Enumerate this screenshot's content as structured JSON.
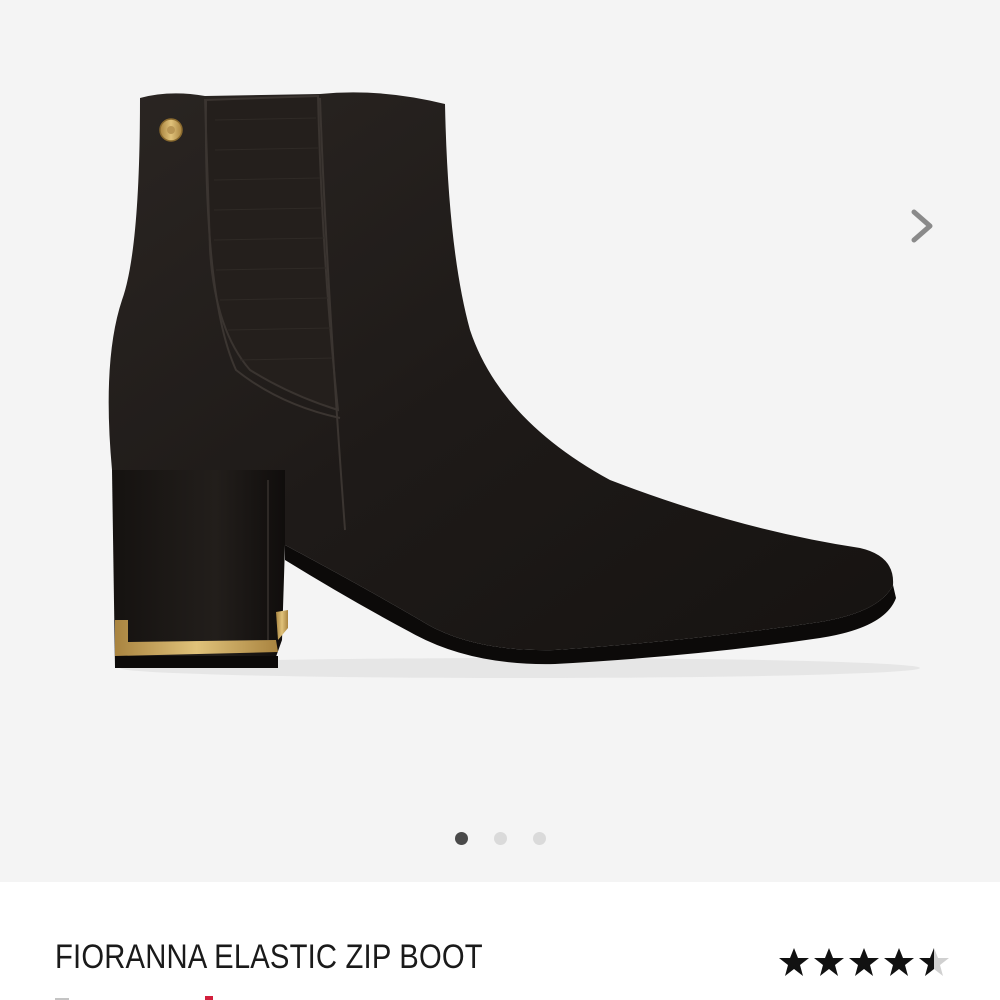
{
  "product": {
    "title": "FIORANNA ELASTIC ZIP BOOT",
    "rating": 4.5,
    "rating_max": 5
  },
  "gallery": {
    "image_count": 3,
    "active_index": 0,
    "next_icon": "chevron-right-icon",
    "background_color": "#f4f4f4"
  },
  "colors": {
    "boot": "#1e1a18",
    "gold_trim": "#c9a255",
    "star": "#111111",
    "dot_active": "#4a4a4a",
    "dot_inactive": "#dadada"
  }
}
